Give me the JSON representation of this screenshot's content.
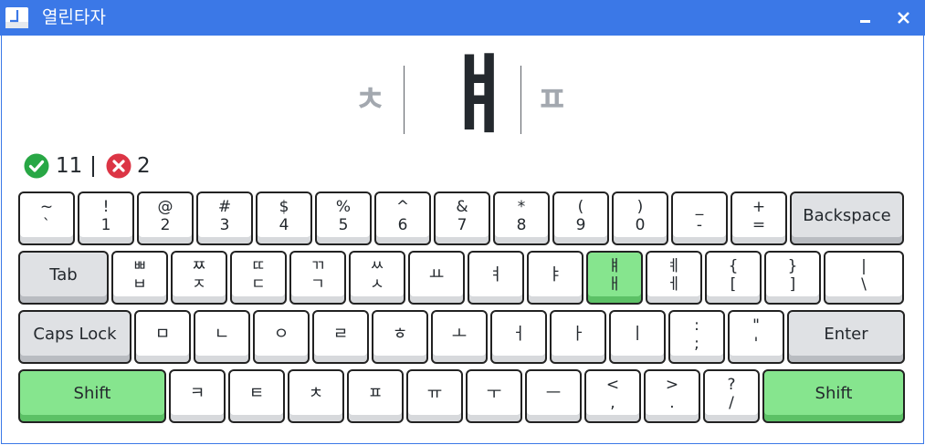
{
  "window": {
    "title": "열린타자"
  },
  "display": {
    "prev_char": "ㅊ",
    "current_char": "ㅒ",
    "next_char": "ㅍ"
  },
  "stats": {
    "correct": "11",
    "wrong": "2"
  },
  "keyboard": {
    "rows": [
      [
        {
          "up": "~",
          "down": "`"
        },
        {
          "up": "!",
          "down": "1"
        },
        {
          "up": "@",
          "down": "2"
        },
        {
          "up": "#",
          "down": "3"
        },
        {
          "up": "$",
          "down": "4"
        },
        {
          "up": "%",
          "down": "5"
        },
        {
          "up": "^",
          "down": "6"
        },
        {
          "up": "&",
          "down": "7"
        },
        {
          "up": "*",
          "down": "8"
        },
        {
          "up": "(",
          "down": "9"
        },
        {
          "up": ")",
          "down": "0"
        },
        {
          "up": "_",
          "down": "-"
        },
        {
          "up": "+",
          "down": "="
        },
        {
          "label": "Backspace"
        }
      ],
      [
        {
          "label": "Tab"
        },
        {
          "up": "ㅃ",
          "down": "ㅂ"
        },
        {
          "up": "ㅉ",
          "down": "ㅈ"
        },
        {
          "up": "ㄸ",
          "down": "ㄷ"
        },
        {
          "up": "ㄲ",
          "down": "ㄱ"
        },
        {
          "up": "ㅆ",
          "down": "ㅅ"
        },
        {
          "label": "ㅛ"
        },
        {
          "label": "ㅕ"
        },
        {
          "label": "ㅑ"
        },
        {
          "up": "ㅒ",
          "down": "ㅐ"
        },
        {
          "up": "ㅖ",
          "down": "ㅔ"
        },
        {
          "up": "{",
          "down": "["
        },
        {
          "up": "}",
          "down": "]"
        },
        {
          "up": "|",
          "down": "\\"
        }
      ],
      [
        {
          "label": "Caps Lock"
        },
        {
          "label": "ㅁ"
        },
        {
          "label": "ㄴ"
        },
        {
          "label": "ㅇ"
        },
        {
          "label": "ㄹ"
        },
        {
          "label": "ㅎ"
        },
        {
          "label": "ㅗ"
        },
        {
          "label": "ㅓ"
        },
        {
          "label": "ㅏ"
        },
        {
          "label": "ㅣ"
        },
        {
          "up": ":",
          "down": ";"
        },
        {
          "up": "\"",
          "down": "'"
        },
        {
          "label": "Enter"
        }
      ],
      [
        {
          "label": "Shift"
        },
        {
          "label": "ㅋ"
        },
        {
          "label": "ㅌ"
        },
        {
          "label": "ㅊ"
        },
        {
          "label": "ㅍ"
        },
        {
          "label": "ㅠ"
        },
        {
          "label": "ㅜ"
        },
        {
          "label": "ㅡ"
        },
        {
          "up": "<",
          "down": ","
        },
        {
          "up": ">",
          "down": "."
        },
        {
          "up": "?",
          "down": "/"
        },
        {
          "label": "Shift"
        }
      ]
    ]
  },
  "colors": {
    "titlebar": "#3b78e7",
    "active_key": "#86e58e",
    "correct": "#28a745",
    "wrong": "#dc3545"
  }
}
